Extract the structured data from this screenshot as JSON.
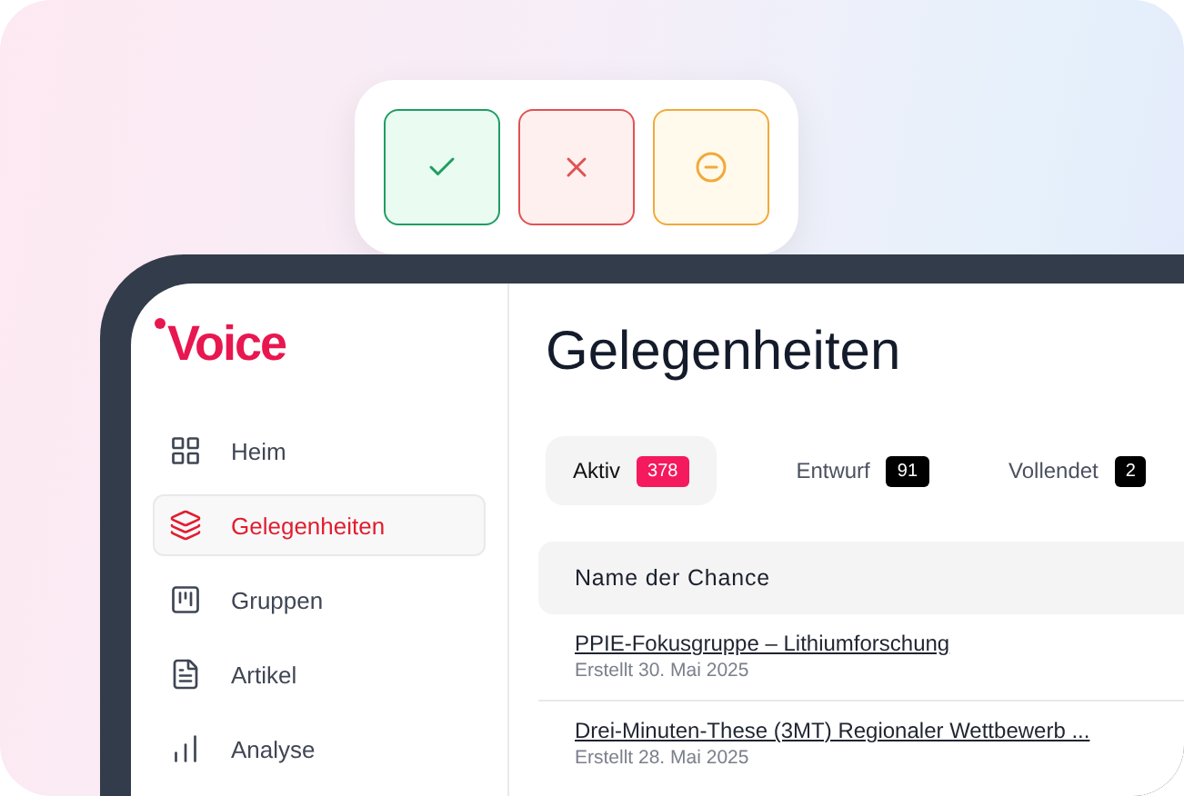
{
  "actions": [
    {
      "kind": "approve",
      "selected": false
    },
    {
      "kind": "reject",
      "selected": false
    },
    {
      "kind": "neutral",
      "selected": false
    }
  ],
  "logo": {
    "text": "Voice"
  },
  "sidebar": {
    "items": [
      {
        "label": "Heim",
        "selected": false
      },
      {
        "label": "Gelegenheiten",
        "selected": true
      },
      {
        "label": "Gruppen",
        "selected": false
      },
      {
        "label": "Artikel",
        "selected": false
      },
      {
        "label": "Analyse",
        "selected": false
      }
    ]
  },
  "page": {
    "title": "Gelegenheiten"
  },
  "tabs": [
    {
      "label": "Aktiv",
      "count": "378",
      "selected": true
    },
    {
      "label": "Entwurf",
      "count": "91",
      "selected": false
    },
    {
      "label": "Vollendet",
      "count": "2",
      "selected": false
    }
  ],
  "table": {
    "columns": [
      "Name der Chance"
    ],
    "rows": [
      {
        "name": "PPIE-Fokusgruppe – Lithiumforschung",
        "created": "Erstellt 30. Mai 2025"
      },
      {
        "name": "Drei-Minuten-These (3MT) Regionaler Wettbewerb ...",
        "created": "Erstellt 28. Mai 2025"
      }
    ]
  }
}
